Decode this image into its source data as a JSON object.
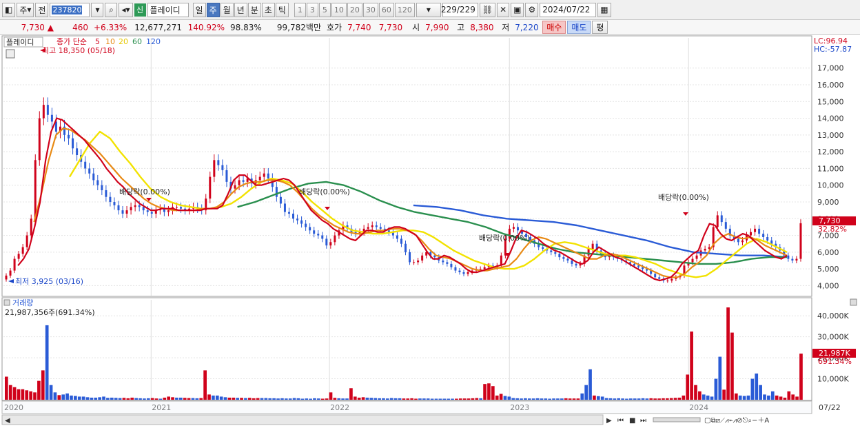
{
  "toolbar": {
    "period_label": "주",
    "prev_label": "전",
    "code": "237820",
    "badge": "신",
    "stock_name": "플레이디",
    "period_buttons": [
      "일",
      "주",
      "월",
      "년",
      "분",
      "초",
      "틱"
    ],
    "active_period": "주",
    "interval_buttons": [
      "1",
      "3",
      "5",
      "10",
      "20",
      "30",
      "60",
      "120"
    ],
    "count": "229/229",
    "date": "2024/07/22"
  },
  "quote": {
    "price": "7,730",
    "change_arrow": "▲",
    "change": "460",
    "change_pct": "+6.33%",
    "volume": "12,677,271",
    "volume_ratio": "140.92%",
    "strength": "98.83%",
    "trade_value": "99,782백만",
    "ask_label": "호가",
    "ask": "7,740",
    "bid": "7,730",
    "open_label": "시",
    "open": "7,990",
    "high_label": "고",
    "high": "8,380",
    "low_label": "저",
    "low": "7,220",
    "buy_button": "매수",
    "sell_button": "매도",
    "avg_button": "평"
  },
  "chart_data": {
    "type": "line",
    "title": "플레이디",
    "legend": {
      "prefix": "종가 단순",
      "periods": [
        "5",
        "10",
        "20",
        "60",
        "120"
      ],
      "colors": [
        "#d0021b",
        "#e88a14",
        "#f2e200",
        "#2a8f4e",
        "#2a5bd6"
      ]
    },
    "ylim": [
      3400,
      18800
    ],
    "yticks": [
      "17,000",
      "16,000",
      "15,000",
      "14,000",
      "13,000",
      "12,000",
      "11,000",
      "10,000",
      "9,000",
      "8,000",
      "7,000",
      "6,000",
      "5,000",
      "4,000"
    ],
    "yticks_values": [
      17000,
      16000,
      15000,
      14000,
      13000,
      12000,
      11000,
      10000,
      9000,
      8000,
      7000,
      6000,
      5000,
      4000
    ],
    "xlabels": [
      "2020",
      "2021",
      "2022",
      "2023",
      "2024",
      "07/22"
    ],
    "price_weekly": [
      4600,
      4900,
      5600,
      5900,
      6300,
      7000,
      8000,
      11500,
      14000,
      14800,
      14200,
      13800,
      13200,
      13500,
      13000,
      12800,
      12200,
      11800,
      11400,
      11000,
      10700,
      10300,
      10000,
      9700,
      9300,
      9000,
      8800,
      8500,
      8300,
      8500,
      8700,
      8800,
      8700,
      8500,
      8400,
      8300,
      8500,
      8600,
      8400,
      8500,
      8700,
      8700,
      8600,
      8500,
      8600,
      8700,
      8600,
      8500,
      9200,
      10500,
      11500,
      11200,
      10900,
      10200,
      9800,
      10000,
      10300,
      10200,
      10400,
      10100,
      10300,
      10500,
      10700,
      10400,
      9900,
      9300,
      8900,
      8400,
      8300,
      8000,
      7900,
      7700,
      7500,
      7300,
      7100,
      7000,
      6800,
      6400,
      6600,
      7000,
      7300,
      7600,
      7400,
      7200,
      7100,
      7200,
      7400,
      7500,
      7600,
      7500,
      7400,
      7300,
      7200,
      7000,
      6800,
      6500,
      6000,
      5400,
      5400,
      5500,
      5800,
      6000,
      5800,
      5700,
      5500,
      5400,
      5300,
      5100,
      4900,
      4800,
      4700,
      4800,
      4900,
      5000,
      5000,
      5100,
      5200,
      5100,
      5200,
      5800,
      6800,
      7400,
      7500,
      7300,
      7100,
      6900,
      6700,
      6500,
      6300,
      6200,
      6100,
      6000,
      5900,
      5700,
      5600,
      5500,
      5300,
      5200,
      5300,
      5800,
      6200,
      6500,
      6100,
      5900,
      5700,
      5800,
      5700,
      5600,
      5500,
      5400,
      5300,
      5200,
      5100,
      5000,
      4900,
      4700,
      4500,
      4400,
      4300,
      4300,
      4400,
      4500,
      4600,
      5200,
      5400,
      5600,
      5800,
      6100,
      6200,
      6300,
      7500,
      8200,
      7800,
      7400,
      7000,
      6800,
      6600,
      6700,
      7000,
      7200,
      7400,
      7100,
      6900,
      6700,
      6500,
      6300,
      6100,
      5800,
      5600,
      5500,
      5600,
      7730
    ],
    "ma5": [
      5200,
      5600,
      6200,
      7500,
      9000,
      11500,
      13200,
      14000,
      13900,
      13600,
      13300,
      13000,
      12700,
      12300,
      11900,
      11500,
      11000,
      10600,
      10200,
      9900,
      9500,
      9200,
      8900,
      8700,
      8500,
      8500,
      8600,
      8600,
      8600,
      8500,
      8500,
      8500,
      8500,
      8500,
      8600,
      8600,
      8600,
      8800,
      9500,
      10300,
      10600,
      10600,
      10300,
      10000,
      10000,
      10100,
      10200,
      10300,
      10400,
      10300,
      10000,
      9500,
      9000,
      8500,
      8200,
      7900,
      7700,
      7400,
      7200,
      7000,
      6800,
      6700,
      7000,
      7300,
      7300,
      7200,
      7200,
      7400,
      7500,
      7500,
      7400,
      7200,
      7000,
      6500,
      6000,
      5600,
      5600,
      5800,
      5700,
      5500,
      5300,
      5000,
      4800,
      4800,
      4900,
      5000,
      5100,
      5200,
      5300,
      6000,
      6800,
      7300,
      7200,
      7000,
      6800,
      6500,
      6300,
      6100,
      6000,
      5800,
      5600,
      5400,
      5300,
      5500,
      6000,
      6300,
      6100,
      5900,
      5700,
      5600,
      5400,
      5200,
      5000,
      4800,
      4600,
      4400,
      4300,
      4400,
      4500,
      4800,
      5300,
      5600,
      5900,
      6100,
      7000,
      7700,
      7600,
      7100,
      6800,
      6700,
      6900,
      7100,
      7000,
      6700,
      6400,
      6100,
      5900,
      5700,
      5600,
      5800
    ],
    "ma10": [
      7800,
      9500,
      11500,
      13000,
      13400,
      13300,
      13000,
      12700,
      12300,
      11900,
      11400,
      10900,
      10400,
      10000,
      9600,
      9200,
      8900,
      8700,
      8600,
      8500,
      8500,
      8500,
      8500,
      8600,
      8600,
      8700,
      9000,
      9500,
      9900,
      10100,
      10200,
      10200,
      10300,
      10300,
      10200,
      10000,
      9600,
      9100,
      8600,
      8200,
      7900,
      7600,
      7400,
      7200,
      7100,
      7100,
      7200,
      7300,
      7300,
      7400,
      7400,
      7300,
      7100,
      6700,
      6200,
      5800,
      5700,
      5600,
      5400,
      5200,
      5000,
      4900,
      4900,
      5000,
      5100,
      5200,
      5600,
      6200,
      6700,
      6900,
      6800,
      6600,
      6400,
      6200,
      6000,
      5800,
      5600,
      5600,
      5800,
      5900,
      5800,
      5600,
      5400,
      5200,
      5000,
      4800,
      4600,
      4500,
      4500,
      4700,
      5100,
      5400,
      5800,
      6500,
      6900,
      7100,
      6900,
      6800,
      6900,
      6700,
      6400,
      6200,
      6000,
      5800
    ],
    "ma20": [
      10500,
      11500,
      12500,
      13200,
      12800,
      12000,
      11300,
      10500,
      9800,
      9300,
      9000,
      8800,
      8700,
      8600,
      8600,
      8700,
      8900,
      9300,
      9800,
      10200,
      10400,
      10300,
      10100,
      9600,
      9000,
      8500,
      8000,
      7600,
      7300,
      7200,
      7100,
      7100,
      7200,
      7300,
      7300,
      7200,
      6900,
      6500,
      6100,
      5800,
      5500,
      5300,
      5100,
      5000,
      5000,
      5200,
      5600,
      6100,
      6500,
      6600,
      6500,
      6300,
      6100,
      5900,
      5800,
      5800,
      5700,
      5500,
      5300,
      5000,
      4800,
      4600,
      4500,
      4600,
      5000,
      5500,
      6000,
      6500,
      6800,
      6600,
      6300,
      6000
    ],
    "ma60": [
      8700,
      9000,
      9400,
      9800,
      10100,
      10200,
      10000,
      9600,
      9100,
      8700,
      8400,
      8200,
      8000,
      7800,
      7500,
      7100,
      6800,
      6500,
      6200,
      6000,
      5900,
      5800,
      5700,
      5600,
      5500,
      5400,
      5300,
      5300,
      5400,
      5600,
      5700,
      5700
    ],
    "ma120": [
      8800,
      8700,
      8500,
      8200,
      8000,
      7900,
      7800,
      7600,
      7300,
      7000,
      6700,
      6300,
      6000,
      5900,
      5800,
      5800,
      5700
    ],
    "annotations": {
      "high_label": "최고 18,350 (05/18)",
      "low_label": "최저 3,925 (03/16)",
      "dividends": [
        "배당락(0.00%)",
        "배당락(0.00%)",
        "배당락(0.00%)",
        "배당락(0.00%)"
      ],
      "lc": "LC:96.94",
      "hc": "HC:-57.87",
      "current_tag": "7,730",
      "current_pct": "32.82%"
    },
    "volume": {
      "title": "거래량",
      "summary": "21,987,356주(691.34%)",
      "yticks": [
        "40,000K",
        "30,000K",
        "20,000K",
        "10,000K"
      ],
      "yticks_values": [
        40000,
        30000,
        20000,
        10000
      ],
      "ylim": [
        0,
        45000
      ],
      "current_tag": "21,987K",
      "current_pct": "691.34%",
      "values": [
        11000,
        7000,
        6000,
        5000,
        5000,
        4500,
        4000,
        3500,
        9000,
        14000,
        35500,
        7000,
        3500,
        2200,
        2500,
        3000,
        2000,
        1800,
        1500,
        1500,
        1200,
        1000,
        1000,
        1200,
        1500,
        900,
        1000,
        900,
        800,
        900,
        700,
        1000,
        800,
        700,
        600,
        700,
        800,
        600,
        500,
        1000,
        1500,
        1200,
        1000,
        1000,
        900,
        800,
        800,
        700,
        800,
        14000,
        2500,
        2000,
        2000,
        1500,
        1200,
        1000,
        1000,
        900,
        900,
        800,
        900,
        700,
        800,
        800,
        800,
        700,
        700,
        600,
        700,
        600,
        600,
        800,
        700,
        500,
        600,
        500,
        700,
        600,
        500,
        600,
        3500,
        900,
        700,
        600,
        600,
        5500,
        1500,
        1000,
        1200,
        1000,
        900,
        800,
        700,
        700,
        600,
        800,
        700,
        700,
        600,
        600,
        700,
        500,
        600,
        600,
        600,
        500,
        500,
        500,
        500,
        500,
        500,
        500,
        600,
        600,
        600,
        700,
        800,
        700,
        7500,
        7800,
        6500,
        2000,
        2800,
        1800,
        1500,
        800,
        700,
        600,
        700,
        600,
        600,
        700,
        600,
        600,
        500,
        600,
        600,
        600,
        700,
        600,
        600,
        600,
        3000,
        7000,
        14500,
        2000,
        1700,
        1500,
        800,
        700,
        600,
        700,
        600,
        500,
        600,
        600,
        600,
        700,
        600,
        700,
        600,
        600,
        700,
        700,
        800,
        900,
        1000,
        2000,
        12000,
        32500,
        7000,
        4000,
        2500,
        2000,
        1500,
        10000,
        20500,
        4800,
        44000,
        32000,
        3000,
        2000,
        1800,
        2000,
        10000,
        12500,
        7000,
        2500,
        2000,
        4000,
        2000,
        1500,
        1000,
        4000,
        2500,
        1500,
        21987
      ]
    }
  }
}
